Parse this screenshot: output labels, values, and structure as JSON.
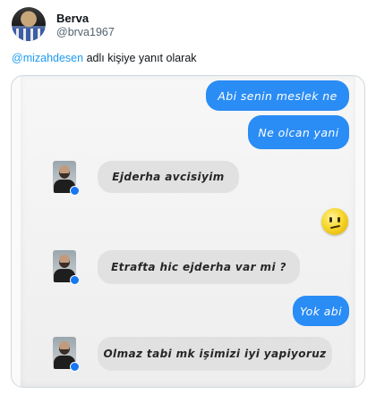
{
  "author": {
    "display_name": "Berva",
    "handle": "@brva1967"
  },
  "reply_context": {
    "mention": "@mizahdesen",
    "text": " adlı kişiye yanıt olarak"
  },
  "chat": {
    "messages": [
      {
        "from": "me",
        "text": "Abi senin meslek ne"
      },
      {
        "from": "me",
        "text": "Ne olcan yani"
      },
      {
        "from": "them",
        "text": "Ejderha avcisiyim"
      },
      {
        "from": "me",
        "emoji": "neutral-face-icon"
      },
      {
        "from": "them",
        "text": "Etrafta hic ejderha var mi ?"
      },
      {
        "from": "me",
        "text": "Yok abi"
      },
      {
        "from": "them",
        "text": "Olmaz tabi mk işimizi iyi yapiyoruz"
      }
    ]
  },
  "colors": {
    "link_blue": "#1d9bf0",
    "sent_bubble": "#2a8cf5",
    "received_bubble": "#e1e1e1",
    "messenger_blue": "#1877f2"
  }
}
